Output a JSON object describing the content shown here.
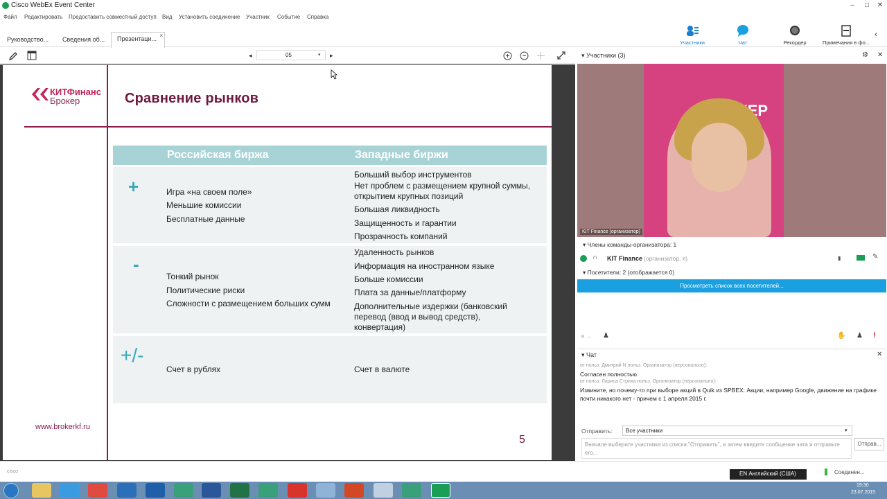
{
  "app": {
    "title": "Cisco WebEx Event Center"
  },
  "window_controls": {
    "minimize": "–",
    "maximize": "□",
    "close": "✕"
  },
  "menu": [
    "Файл",
    "Редактировать",
    "Предоставить совместный доступ",
    "Вид",
    "Установить соединение",
    "Участник",
    "Событие",
    "Справка"
  ],
  "tabs": [
    {
      "label": "Руководство..."
    },
    {
      "label": "Сведения об..."
    },
    {
      "label": "Презентаци...",
      "close": "×"
    }
  ],
  "tools": [
    {
      "label": "Участники",
      "icon": "participants-icon",
      "color": "#1a7fd0"
    },
    {
      "label": "Чат",
      "icon": "chat-icon",
      "color": "#1a7fd0"
    },
    {
      "label": "Рекордер",
      "icon": "record-icon"
    },
    {
      "label": "Примечания в фо...",
      "icon": "notes-icon"
    }
  ],
  "toolbar": {
    "page_value": "05"
  },
  "slide": {
    "logo_line1": "КИТФинанс",
    "logo_line2": "Брокер",
    "title": "Сравнение рынков",
    "col1_header": "Российская биржа",
    "col2_header": "Западные биржи",
    "plus_symbol": "+",
    "minus_symbol": "-",
    "plusminus_symbol": "+/-",
    "plus_ru": [
      "Игра «на своем поле»",
      "Меньшие комиссии",
      "Бесплатные данные"
    ],
    "plus_west": [
      "Больший выбор инструментов",
      "Нет проблем с размещением крупной суммы, открытием крупных позиций",
      "Большая ликвидность",
      "Защищенность и гарантии",
      "Прозрачность компаний"
    ],
    "minus_ru": [
      "Тонкий рынок",
      "Политические риски",
      "Сложности с размещением больших сумм"
    ],
    "minus_west": [
      "Удаленность рынков",
      "Информация на иностранном языке",
      "Больше комиссии",
      "Плата за данные/платформу",
      "Дополнительные издержки (банковский перевод (ввод и вывод средств), конвертация)"
    ],
    "pm_ru": "Счет в рублях",
    "pm_west": "Счет в валюте",
    "url": "www.brokerkf.ru",
    "page_number": "5",
    "accent_color": "#8c1c4e",
    "header_color": "#a8d3d6"
  },
  "participants": {
    "header": "Участники (3)",
    "video_caption": "KIT Finance (организатор)",
    "video_banner_text": "БРОКЕР",
    "host_group": "Члены команды-организатора: 1",
    "host_name": "KIT Finance",
    "host_role": "(организатор, я)",
    "attendees_group": "Посетители: 2 (отображается 0)",
    "view_all_button": "Просмотреть список всех посетителей..."
  },
  "chat": {
    "header": "Чат",
    "messages": [
      {
        "meta": "от польз. Дмитрий N польз. Организатор (персонально):",
        "text": "Согласен полностью"
      },
      {
        "meta": "от польз. Лариса Стриха польз. Организатор (персонально):",
        "text": "Извините, но почему-то при выборе акций в Quik из SPBEX: Акции, например Google, движение на графике почти никакого нет - причем с 1 апреля 2015 г."
      }
    ],
    "send_label": "Отправить:",
    "recipient": "Все участники",
    "input_placeholder": "Вначале выберите участника из списка \"Отправить\", а затем введите сообщение чата и отправьте его...",
    "send_button": "Отправ..."
  },
  "status": {
    "cisco_logo": "cisco",
    "language": "EN Английский (США)",
    "connection": "Соединен...",
    "time": "19:30",
    "date": "23.07.2015"
  }
}
